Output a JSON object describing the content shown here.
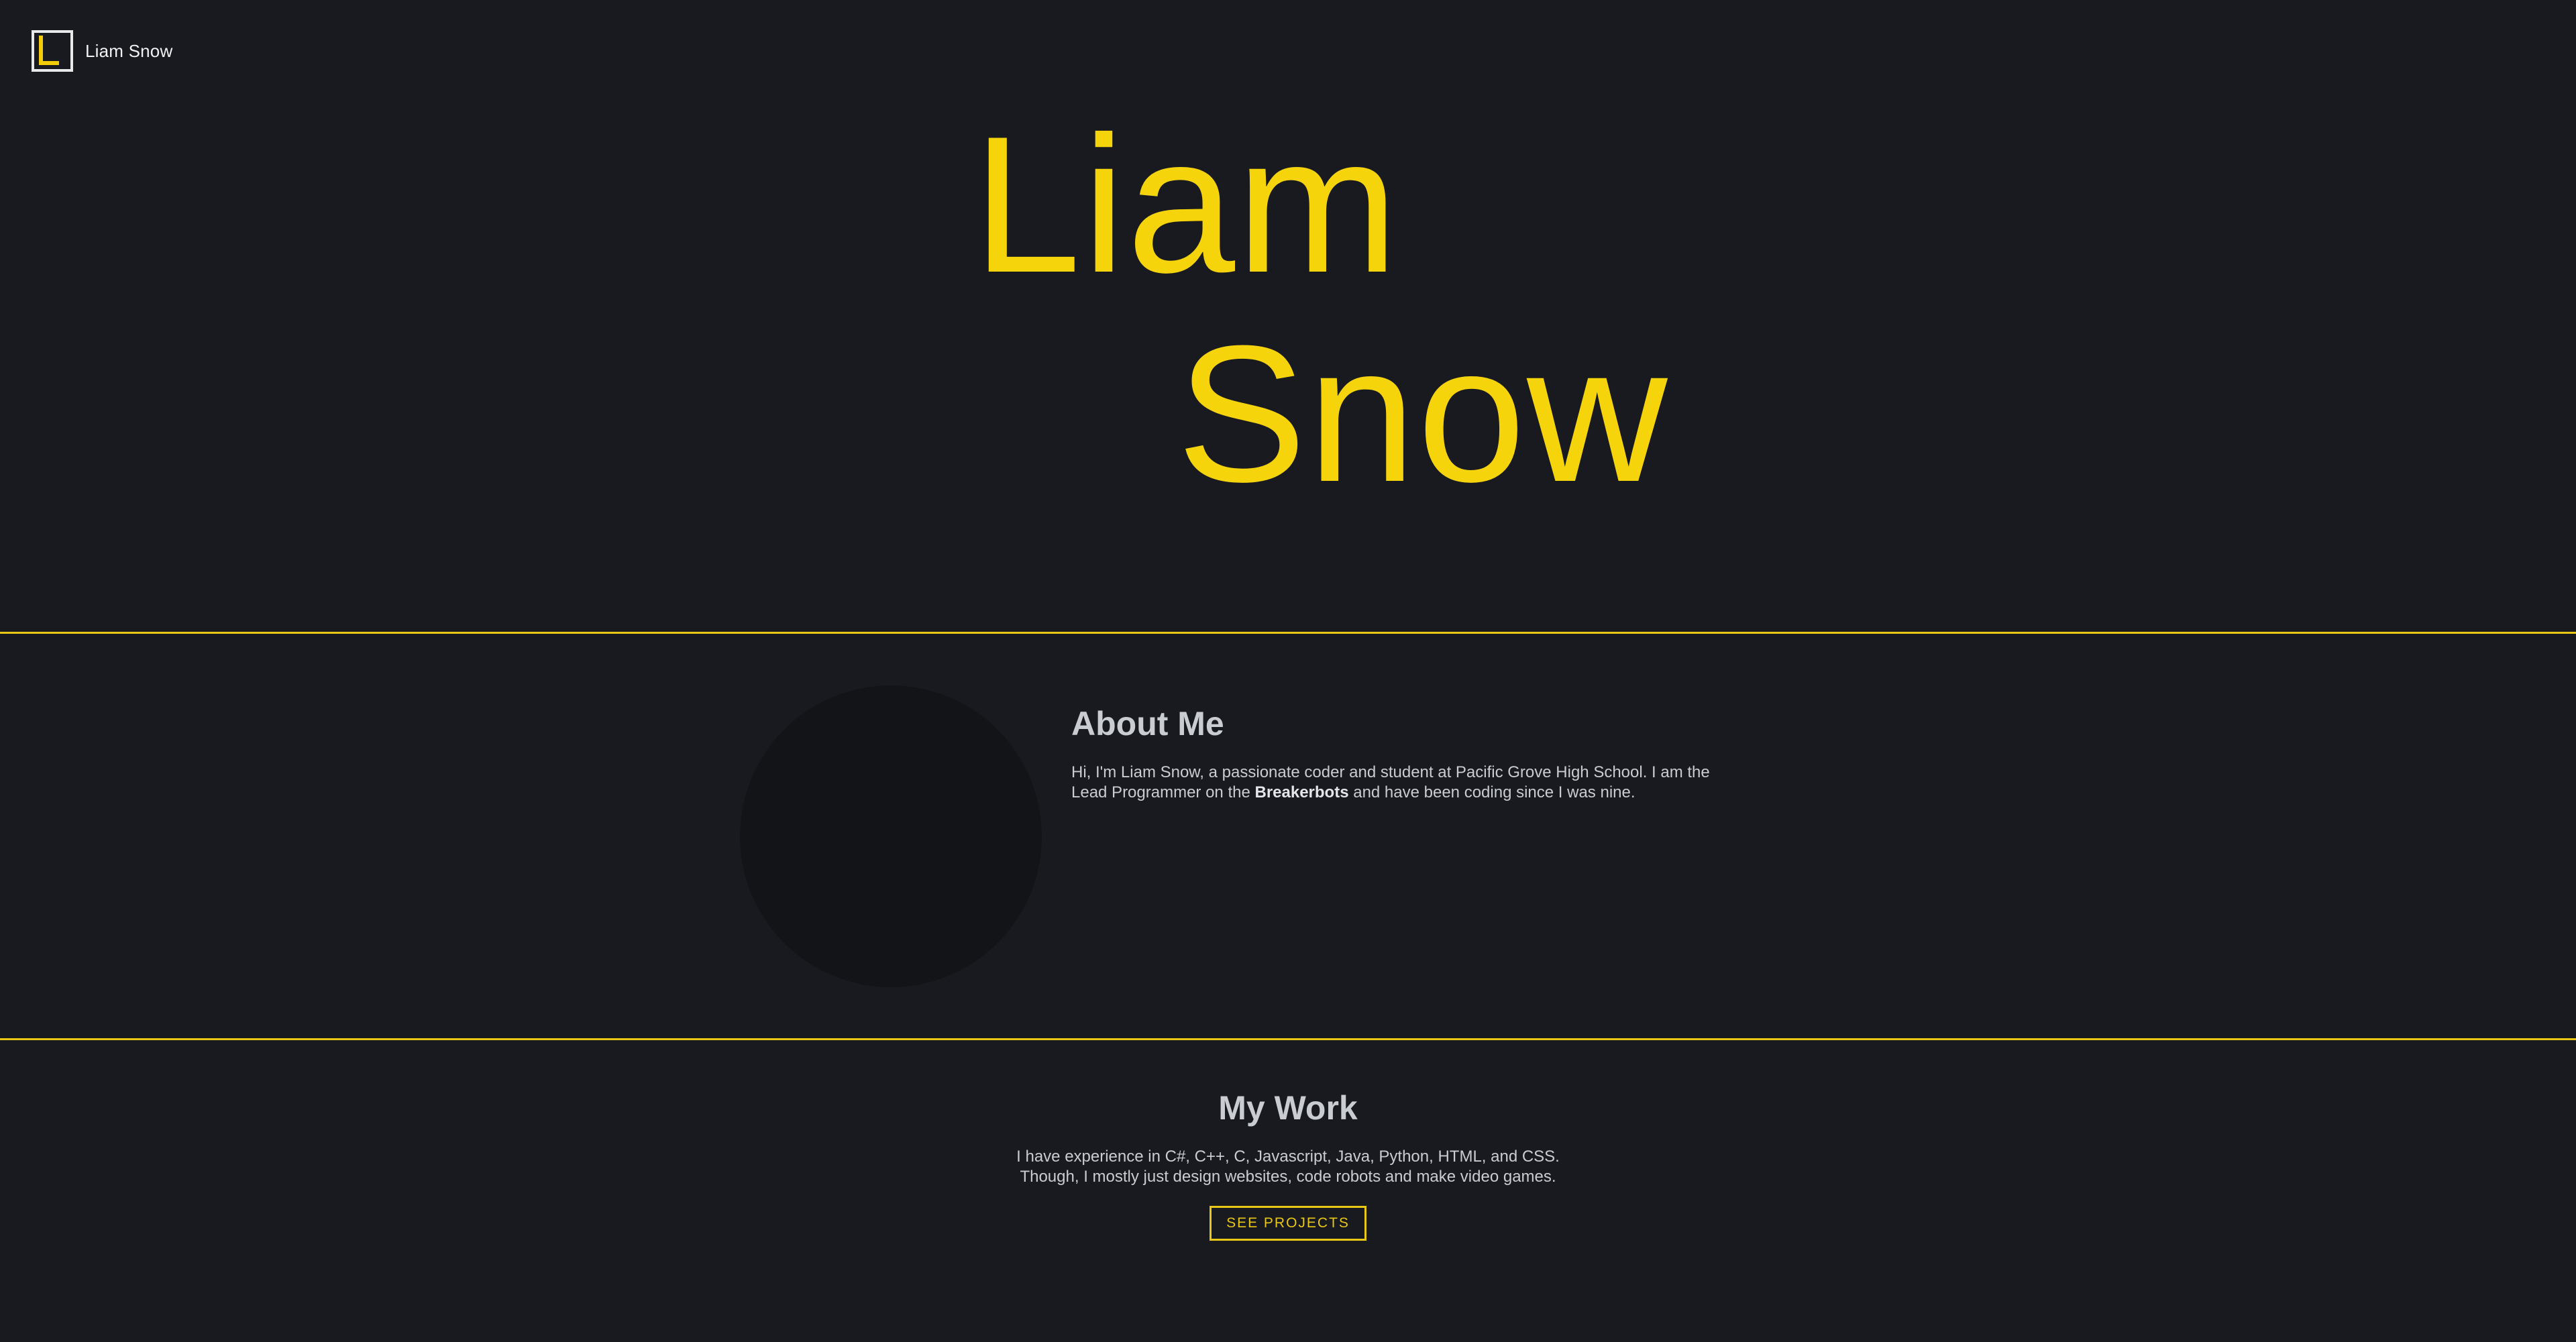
{
  "header": {
    "brand_name": "Liam Snow",
    "logo_icon": "bracket-l-logo-icon"
  },
  "hero": {
    "first_name": "Liam",
    "last_name": "Snow"
  },
  "about": {
    "title": "About Me",
    "text_before": "Hi, I'm Liam Snow, a passionate coder and student at Pacific Grove High School. I am the Lead Programmer on the ",
    "team_name": "Breakerbots",
    "text_after": " and have been coding since I was nine."
  },
  "work": {
    "title": "My Work",
    "text": "I have experience in C#, C++, C, Javascript, Java, Python, HTML, and CSS. Though, I mostly just design websites, code robots and make video games.",
    "button_label": "SEE PROJECTS"
  },
  "colors": {
    "accent": "#f6d40b",
    "background": "#181a1f",
    "text": "#c9ccd1"
  }
}
